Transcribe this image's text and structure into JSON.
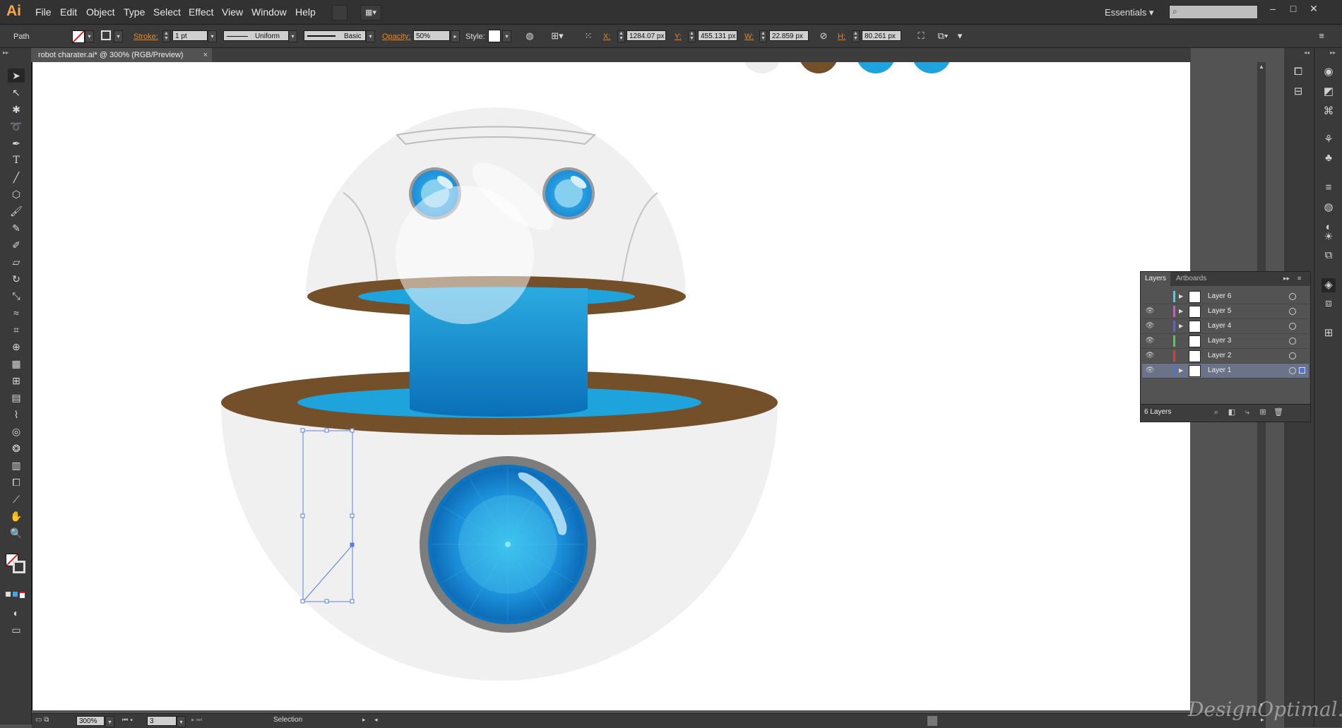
{
  "app": {
    "logo": "Ai"
  },
  "menu": [
    "File",
    "Edit",
    "Object",
    "Type",
    "Select",
    "Effect",
    "View",
    "Window",
    "Help"
  ],
  "workspace": {
    "label": "Essentials"
  },
  "controlbar": {
    "object_type": "Path",
    "stroke_label": "Stroke:",
    "stroke_weight": "1 pt",
    "profile": "Uniform",
    "brush": "Basic",
    "opacity_label": "Opacity:",
    "opacity": "50%",
    "style_label": "Style:",
    "x_label": "X:",
    "x": "1284.07 px",
    "y_label": "Y:",
    "y": "455.131 px",
    "w_label": "W:",
    "w": "22.859 px",
    "h_label": "H:",
    "h": "80.261 px"
  },
  "document": {
    "tab_title": "robot charater.ai* @ 300% (RGB/Preview)"
  },
  "status": {
    "zoom": "300%",
    "artboard": "3",
    "tool": "Selection"
  },
  "layers_panel": {
    "tabs": [
      "Layers",
      "Artboards"
    ],
    "layers": [
      {
        "name": "Layer 6",
        "color": "#3ed7e8",
        "visible": false,
        "selected": false
      },
      {
        "name": "Layer 5",
        "color": "#d64fd4",
        "visible": true,
        "selected": false
      },
      {
        "name": "Layer 4",
        "color": "#5a61e6",
        "visible": true,
        "selected": false
      },
      {
        "name": "Layer 3",
        "color": "#4fd14a",
        "visible": true,
        "selected": false
      },
      {
        "name": "Layer 2",
        "color": "#e03c3c",
        "visible": true,
        "selected": false
      },
      {
        "name": "Layer 1",
        "color": "#4f72d8",
        "visible": true,
        "selected": true
      }
    ],
    "count": "6 Layers"
  },
  "watermark": "DesignOptimal.com",
  "colors": {
    "brown": "#74502a",
    "blue": "#1ea3dc",
    "dark_blue": "#0a6fb7",
    "dome": "#f0f0f0"
  }
}
